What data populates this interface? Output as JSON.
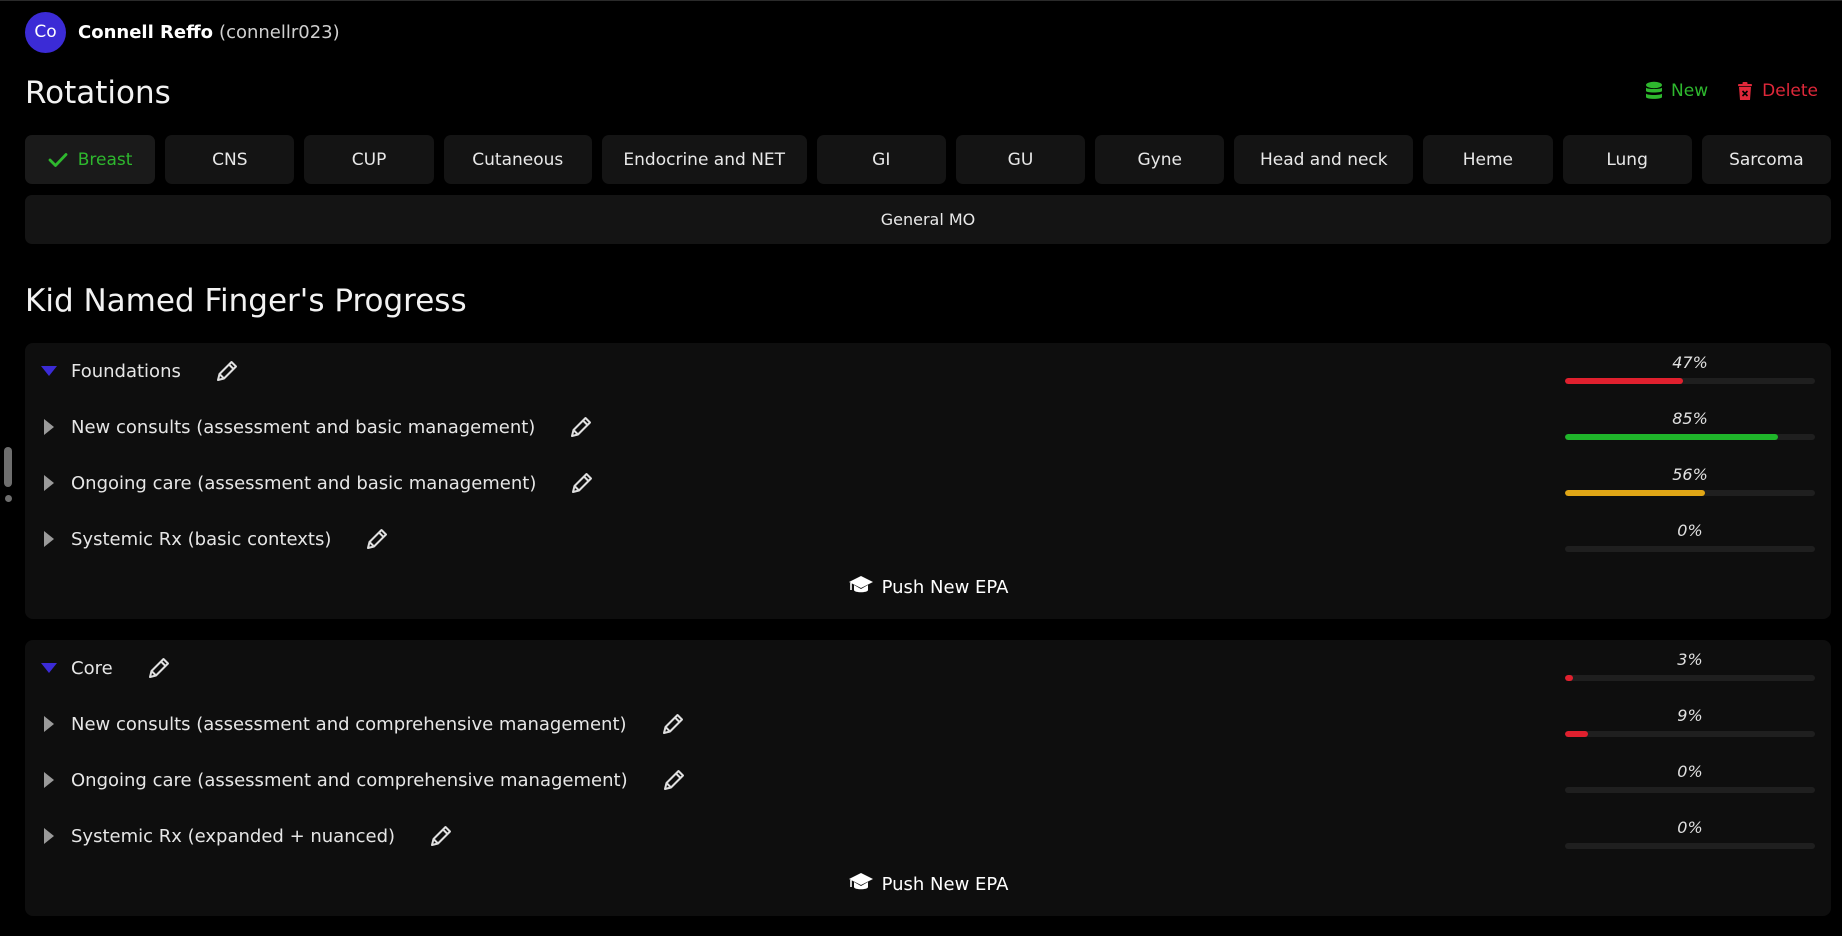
{
  "user": {
    "avatar_initials": "Co",
    "name": "Connell Reffo",
    "handle": "(connellr023)"
  },
  "page_title": "Rotations",
  "actions": {
    "new_label": "New",
    "delete_label": "Delete"
  },
  "tabs": [
    {
      "label": "Breast",
      "active": true
    },
    {
      "label": "CNS"
    },
    {
      "label": "CUP"
    },
    {
      "label": "Cutaneous"
    },
    {
      "label": "Endocrine and NET"
    },
    {
      "label": "GI"
    },
    {
      "label": "GU"
    },
    {
      "label": "Gyne"
    },
    {
      "label": "Head and neck"
    },
    {
      "label": "Heme"
    },
    {
      "label": "Lung"
    },
    {
      "label": "Sarcoma"
    }
  ],
  "general_tab": "General MO",
  "progress_title": "Kid Named Finger's Progress",
  "push_label": "Push New EPA",
  "sections": [
    {
      "title": "Foundations",
      "expanded": true,
      "percent_label": "47%",
      "percent": 47,
      "color": "#e0202e",
      "items": [
        {
          "label": "New consults (assessment and basic management)",
          "percent_label": "85%",
          "percent": 85,
          "color": "#1fb52a"
        },
        {
          "label": "Ongoing care (assessment and basic management)",
          "percent_label": "56%",
          "percent": 56,
          "color": "#e0a616"
        },
        {
          "label": "Systemic Rx (basic contexts)",
          "percent_label": "0%",
          "percent": 0,
          "color": "#e0202e"
        }
      ]
    },
    {
      "title": "Core",
      "expanded": true,
      "percent_label": "3%",
      "percent": 3,
      "color": "#e0202e",
      "items": [
        {
          "label": "New consults (assessment and comprehensive management)",
          "percent_label": "9%",
          "percent": 9,
          "color": "#e0202e"
        },
        {
          "label": "Ongoing care (assessment and comprehensive management)",
          "percent_label": "0%",
          "percent": 0,
          "color": "#e0202e"
        },
        {
          "label": "Systemic Rx (expanded + nuanced)",
          "percent_label": "0%",
          "percent": 0,
          "color": "#e0202e"
        }
      ]
    }
  ],
  "colors": {
    "accent_purple": "#3b2bd6",
    "success_green": "#2eb82e",
    "danger_red": "#e0283a"
  }
}
